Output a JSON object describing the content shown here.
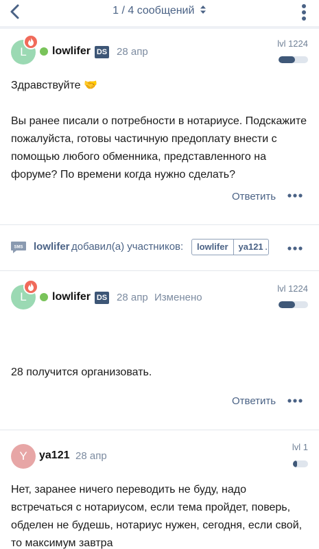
{
  "header": {
    "title": "1 / 4 сообщений"
  },
  "posts": [
    {
      "avatar_letter": "L",
      "username": "lowlifer",
      "badge": "DS",
      "date": "28 апр",
      "level": "lvl 1224",
      "level_fraction": 0.55,
      "text": "Здравствуйте 🤝\n\nВы ранее писали о потребности в нотариусе. Подскажите пожалуйста, готовы частичную предоплату внести с помощью любого обменника, представленного на форуме? По времени когда нужно сделать?",
      "reply_label": "Ответить"
    },
    {
      "avatar_letter": "L",
      "username": "lowlifer",
      "badge": "DS",
      "date": "28 апр",
      "edited_label": "Изменено",
      "level": "lvl 1224",
      "level_fraction": 0.55,
      "text": "28 получится организовать.",
      "reply_label": "Ответить"
    },
    {
      "avatar_letter": "Y",
      "username": "ya121",
      "date": "28 апр",
      "level": "lvl 1",
      "level_fraction": 0.25,
      "text": "Нет, заранее ничего переводить не буду, надо встречаться с нотариусом, если тема пройдет, поверь, обделен не будешь, нотариус нужен, сегодня, если свой, то максимум завтра"
    }
  ],
  "system_message": {
    "icon_text": "SMS",
    "user": "lowlifer",
    "action": "добавил(а) участников:",
    "participants": [
      "lowlifer",
      "ya121"
    ],
    "trailing": "."
  },
  "colors": {
    "accent": "#4a6285",
    "badge": "#3d5676",
    "online": "#79c35a",
    "fire": "#f06a5a"
  }
}
